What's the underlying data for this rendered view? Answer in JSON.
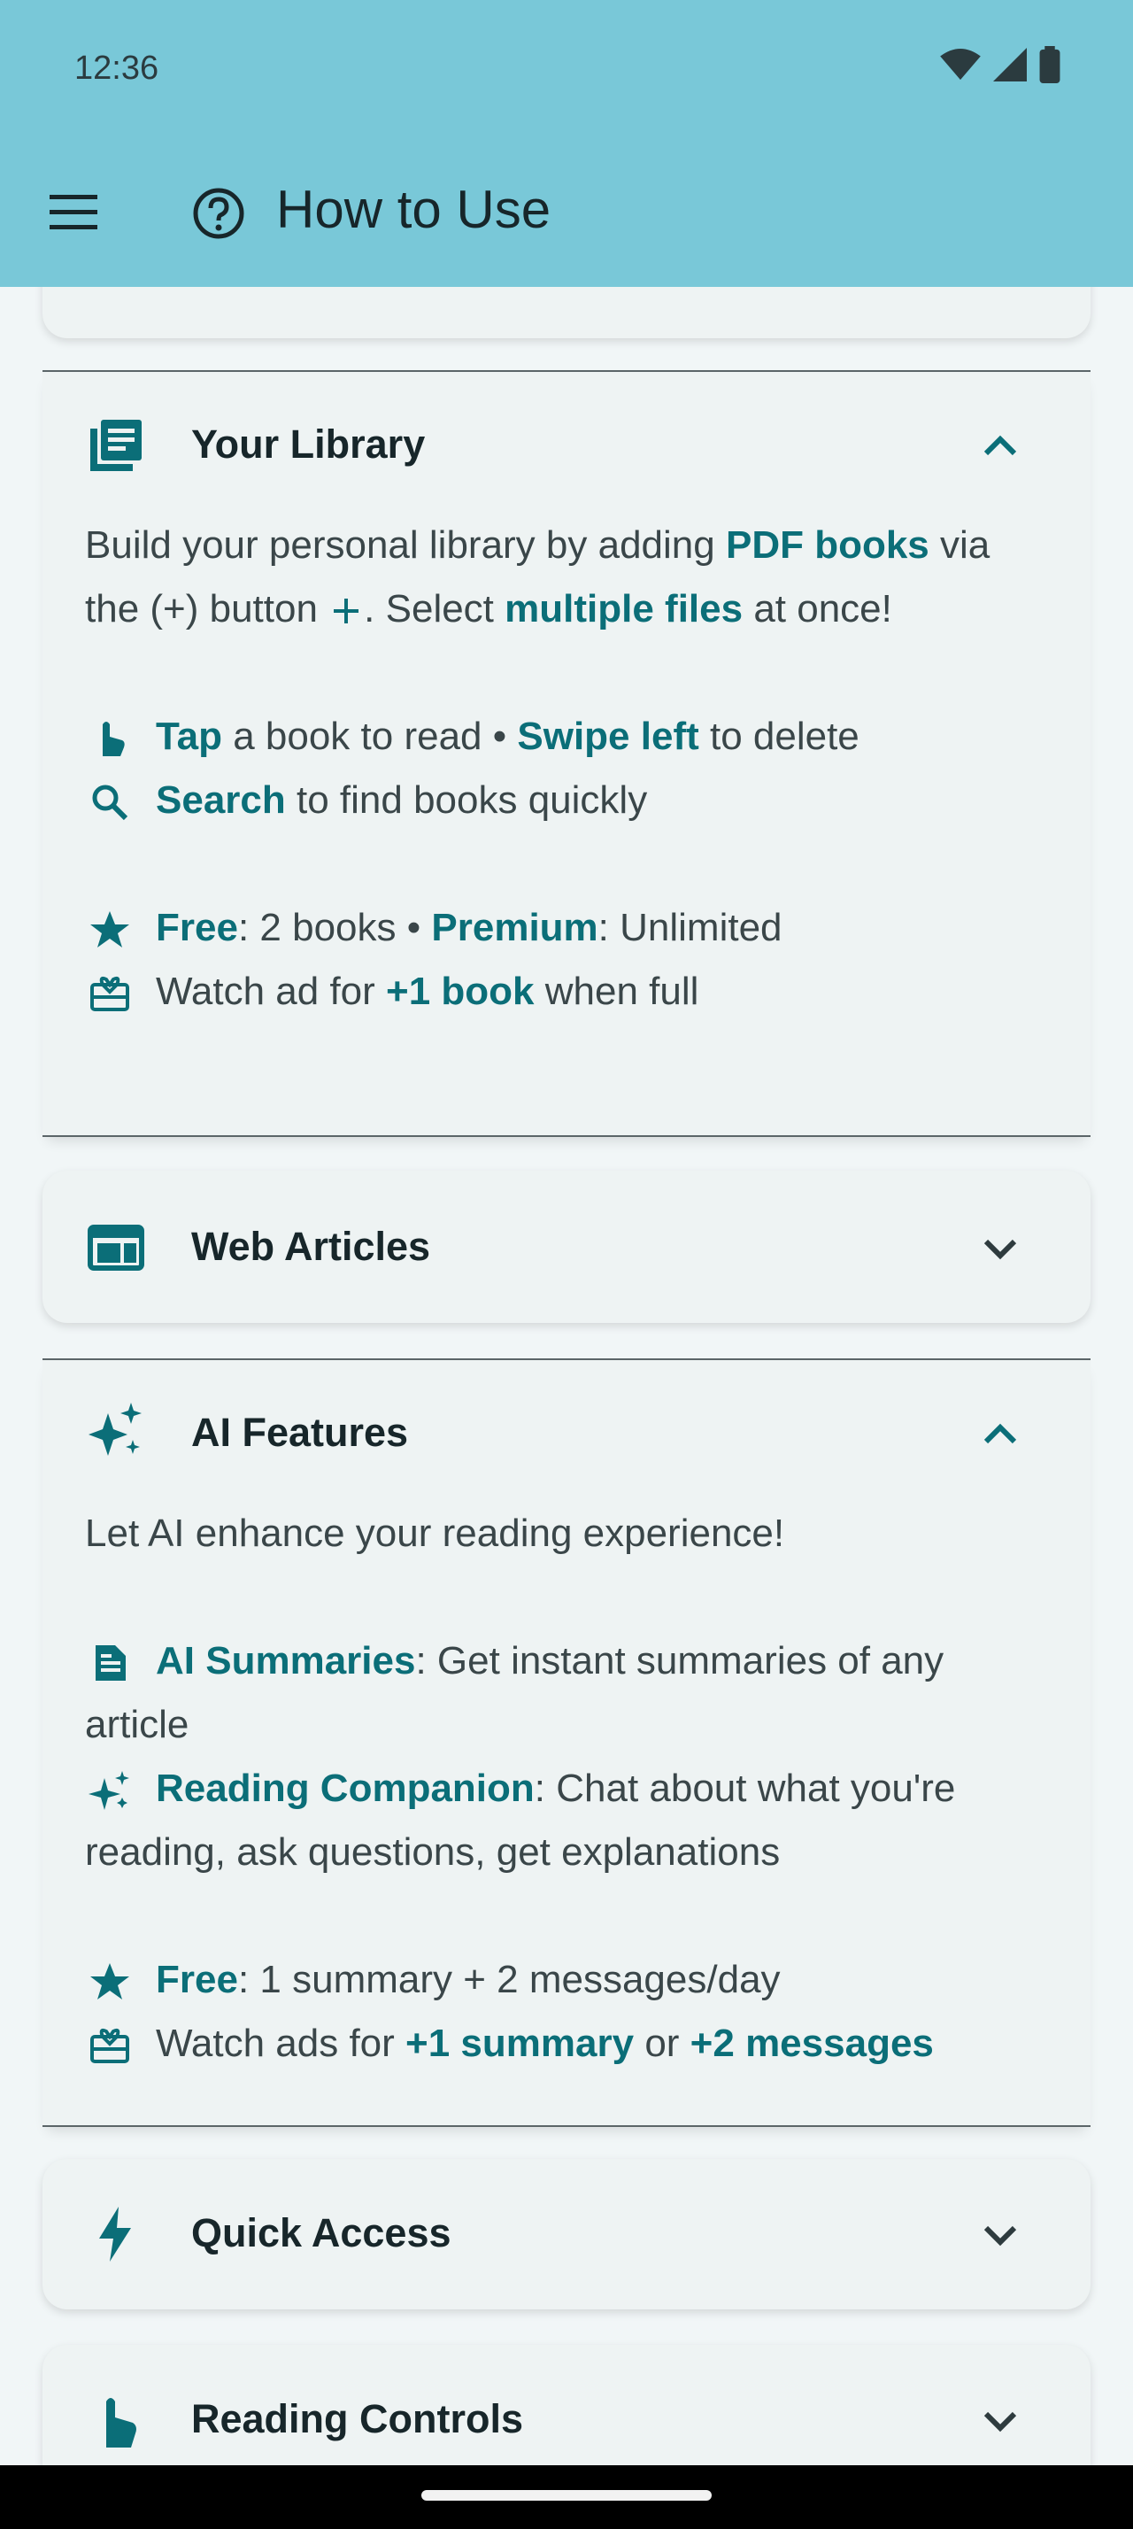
{
  "status_bar": {
    "time": "12:36"
  },
  "app_bar": {
    "title": "How to Use",
    "menu_icon": "hamburger-menu-icon",
    "help_icon": "help-circle-icon"
  },
  "colors": {
    "app_bar": "#79c8d8",
    "accent": "#0b6e78",
    "background": "#f1f6f7",
    "card": "#eef3f3"
  },
  "sections": {
    "library": {
      "title": "Your Library",
      "icon": "library-books-icon",
      "expanded": true,
      "intro_1": "Build your personal library by adding ",
      "intro_pdf": "PDF books",
      "intro_2": " via the (+) button ",
      "intro_3": ". Select ",
      "intro_multi": "multiple files",
      "intro_4": " at once!",
      "tap": "Tap",
      "tap_rest": " a book to read • ",
      "swipe": "Swipe left",
      "swipe_rest": " to delete",
      "search": "Search",
      "search_rest": " to find books quickly",
      "free": "Free",
      "free_rest": ": 2 books • ",
      "premium": "Premium",
      "premium_rest": ": Unlimited",
      "watch_1": "Watch ad for ",
      "watch_hl": "+1 book",
      "watch_2": " when full"
    },
    "web": {
      "title": "Web Articles",
      "icon": "web-article-icon",
      "expanded": false
    },
    "ai": {
      "title": "AI Features",
      "icon": "sparkles-icon",
      "expanded": true,
      "intro": "Let AI enhance your reading experience!",
      "summaries": "AI Summaries",
      "summaries_rest": ": Get instant summaries of any article",
      "companion": "Reading Companion",
      "companion_rest": ": Chat about what you're reading, ask questions, get explanations",
      "free": "Free",
      "free_rest": ": 1 summary + 2 messages/day",
      "watch_1": "Watch ads for ",
      "watch_hl1": "+1 summary",
      "watch_mid": " or ",
      "watch_hl2": "+2 messages"
    },
    "quick": {
      "title": "Quick Access",
      "icon": "lightning-bolt-icon",
      "expanded": false
    },
    "reading": {
      "title": "Reading Controls",
      "icon": "touch-hand-icon",
      "expanded": false
    }
  }
}
